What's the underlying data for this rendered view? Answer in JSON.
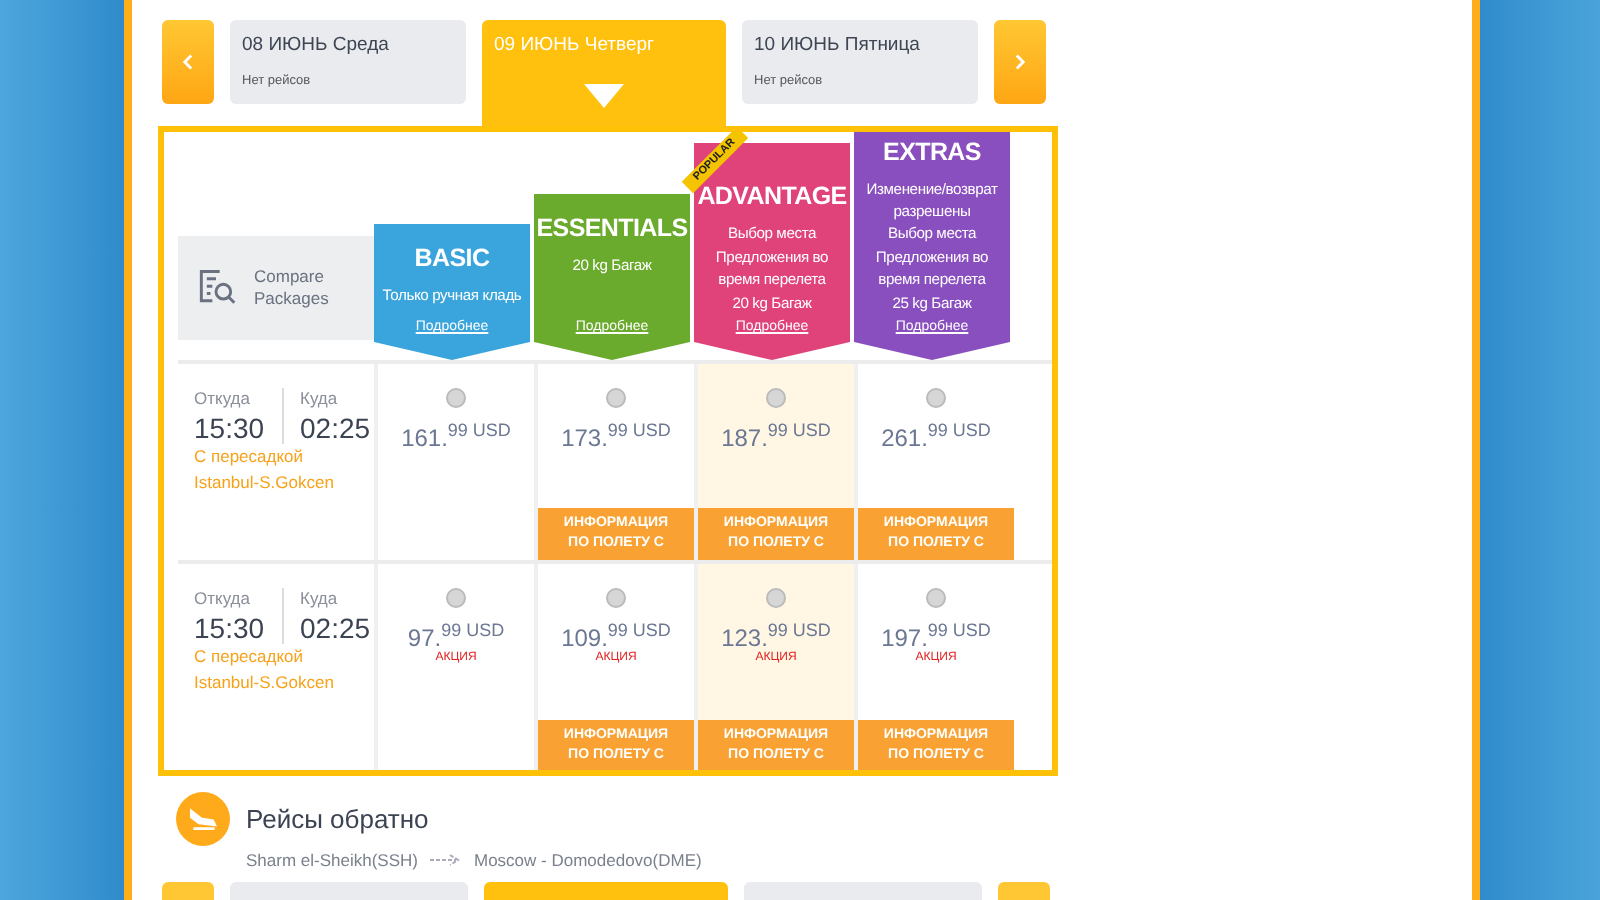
{
  "days": [
    {
      "date": "08 ИЮНЬ Среда",
      "note": "Нет рейсов",
      "selected": false
    },
    {
      "date": "09 ИЮНЬ Четверг",
      "selected": true
    },
    {
      "date": "10 ИЮНЬ Пятница",
      "note": "Нет рейсов",
      "selected": false
    }
  ],
  "compare": {
    "label": "Compare Packages"
  },
  "packages": [
    {
      "name": "BASIC",
      "color": "#3aa5dc",
      "highlighted": false,
      "lines": [
        "Только ручная кладь"
      ],
      "link": "Подробнее"
    },
    {
      "name": "ESSENTIALS",
      "color": "#6aaa2c",
      "highlighted": false,
      "lines": [
        "20 kg Багаж"
      ],
      "link": "Подробнее"
    },
    {
      "name": "ADVANTAGE",
      "color": "#e0437a",
      "highlighted": true,
      "badge": "POPULAR",
      "lines": [
        "Выбор места",
        "Предложения во время перелета",
        "20 kg Багаж"
      ],
      "link": "Подробнее"
    },
    {
      "name": "EXTRAS",
      "color": "#8a4fbf",
      "highlighted": false,
      "lines": [
        "Изменение/возврат разрешены",
        "Выбор места",
        "Предложения во время перелета",
        "25 kg Багаж"
      ],
      "link": "Подробнее"
    }
  ],
  "flights": [
    {
      "from_label": "Откуда",
      "to_label": "Куда",
      "depart": "15:30",
      "arrive": "02:25",
      "transfer": "С пересадкой",
      "via": "Istanbul-S.Gokcen",
      "fares": [
        {
          "price": "161.$^{99 USD}$",
          "selected": false
        },
        {
          "price": "173.$^{99 USD}$",
          "selected": false,
          "info": "ИНФОРМАЦИЯ ПО ПОЛЕТУ С"
        },
        {
          "price": "187.$^{99 USD}$",
          "selected": false,
          "info": "ИНФОРМАЦИЯ ПО ПОЛЕТУ С"
        },
        {
          "price": "261.$^{99 USD}$",
          "selected": false,
          "info": "ИНФОРМАЦИЯ ПО ПОЛЕТУ С"
        }
      ]
    },
    {
      "from_label": "Откуда",
      "to_label": "Куда",
      "depart": "15:30",
      "arrive": "02:25",
      "transfer": "С пересадкой",
      "via": "Istanbul-S.Gokcen",
      "fares": [
        {
          "price": "97.$^{99 USD}$",
          "promo": "АКЦИЯ",
          "selected": false
        },
        {
          "price": "109.$^{99 USD}$",
          "promo": "АКЦИЯ",
          "selected": false,
          "info": "ИНФОРМАЦИЯ ПО ПОЛЕТУ С"
        },
        {
          "price": "123.$^{99 USD}$",
          "promo": "АКЦИЯ",
          "selected": false,
          "info": "ИНФОРМАЦИЯ ПО ПОЛЕТУ С"
        },
        {
          "price": "197.$^{99 USD}$",
          "promo": "АКЦИЯ",
          "selected": false,
          "info": "ИНФОРМАЦИЯ ПО ПОЛЕТУ С"
        }
      ]
    }
  ],
  "return": {
    "title": "Рейсы обратно",
    "from": "Sharm el-Sheikh(SSH)",
    "to": "Moscow - Domodedovo(DME)",
    "days": [
      {
        "selected": false
      },
      {
        "selected": true
      },
      {
        "selected": false
      }
    ]
  }
}
